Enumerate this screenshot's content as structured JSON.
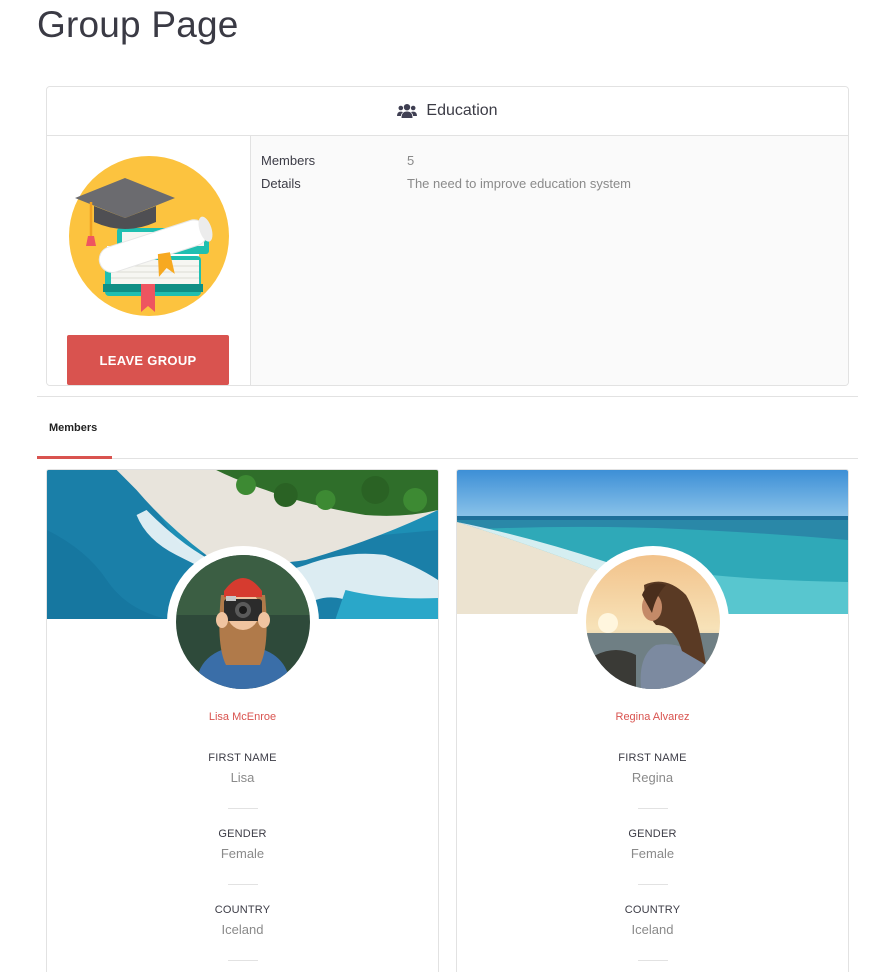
{
  "page": {
    "title": "Group Page"
  },
  "group": {
    "name": "Education",
    "icon": "users-icon",
    "leave_button": "LEAVE GROUP",
    "info": [
      {
        "key": "Members",
        "value": "5"
      },
      {
        "key": "Details",
        "value": "The need to improve education system"
      }
    ]
  },
  "tabs": [
    {
      "label": "Members",
      "active": true
    }
  ],
  "members": [
    {
      "name": "Lisa McEnroe",
      "fields": [
        {
          "label": "FIRST NAME",
          "value": "Lisa"
        },
        {
          "label": "GENDER",
          "value": "Female"
        },
        {
          "label": "COUNTRY",
          "value": "Iceland"
        }
      ]
    },
    {
      "name": "Regina Alvarez",
      "fields": [
        {
          "label": "FIRST NAME",
          "value": "Regina"
        },
        {
          "label": "GENDER",
          "value": "Female"
        },
        {
          "label": "COUNTRY",
          "value": "Iceland"
        }
      ]
    }
  ],
  "colors": {
    "accent": "#d9534f",
    "text": "#3c3c46",
    "muted": "#8a8a8a",
    "border": "#e2e2e2"
  }
}
